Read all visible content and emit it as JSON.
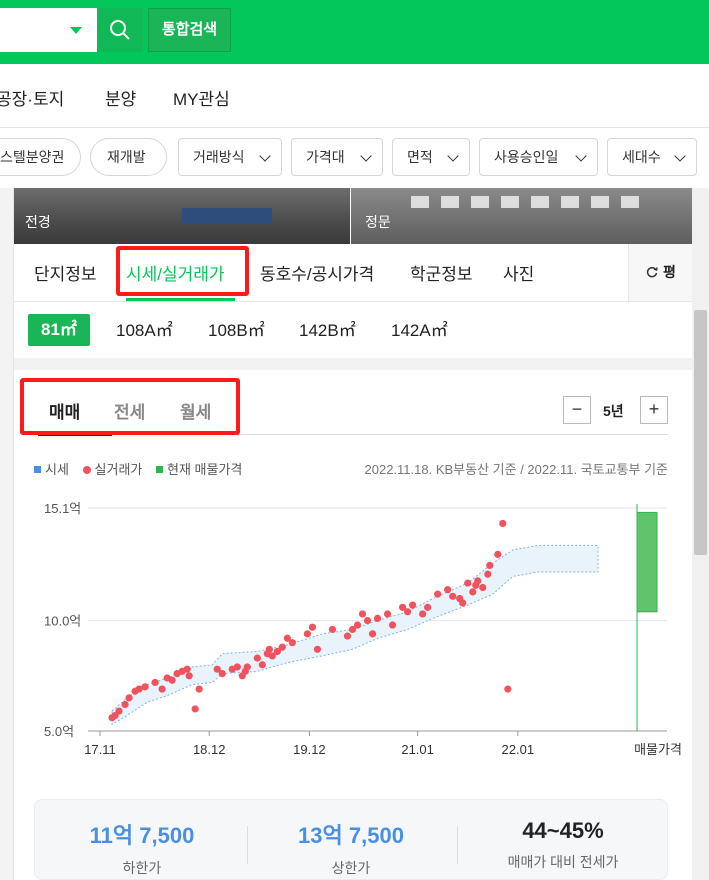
{
  "header": {
    "total_search": "통합검색"
  },
  "gnb": [
    "공장·토지",
    "분양",
    "MY관심"
  ],
  "filters": [
    "스텔분양권",
    "재개발",
    "거래방식",
    "가격대",
    "면적",
    "사용승인일",
    "세대수"
  ],
  "photos": {
    "left_label": "전경",
    "right_label": "정문"
  },
  "tabs": {
    "items": [
      "단지정보",
      "시세/실거래가",
      "동호수/공시가격",
      "학군정보",
      "사진"
    ],
    "active": 1,
    "unit": "평"
  },
  "sizes": {
    "items": [
      "81㎡",
      "108A㎡",
      "108B㎡",
      "142B㎡",
      "142A㎡"
    ],
    "active": 0
  },
  "trade_tabs": {
    "items": [
      "매매",
      "전세",
      "월세"
    ],
    "active": 0
  },
  "period": {
    "minus": "−",
    "label": "5년",
    "plus": "+"
  },
  "legend": {
    "market": "시세",
    "actual": "실거래가",
    "listing": "현재 매물가격",
    "source": "2022.11.18. KB부동산 기준 / 2022.11. 국토교통부 기준",
    "colors": {
      "market": "#4a90e2",
      "actual": "#f0525e",
      "listing": "#2db84d"
    }
  },
  "chart_data": {
    "type": "scatter",
    "y_unit": "억",
    "ylim": [
      5.0,
      15.1
    ],
    "yticks": [
      {
        "value": 5.0,
        "label": "5.0억"
      },
      {
        "value": 10.0,
        "label": "10.0억"
      },
      {
        "value": 15.1,
        "label": "15.1억"
      }
    ],
    "xlim": [
      2017.83,
      2022.92
    ],
    "xticks": [
      {
        "value": 2017.83,
        "label": "17.11"
      },
      {
        "value": 2018.92,
        "label": "18.12"
      },
      {
        "value": 2019.92,
        "label": "19.12"
      },
      {
        "value": 2021.0,
        "label": "21.01"
      },
      {
        "value": 2022.0,
        "label": "22.01"
      }
    ],
    "extra_xlabel": "매물가격",
    "grid": true,
    "series": [
      {
        "name": "시세",
        "band": [
          {
            "x": 2017.95,
            "low": 5.3,
            "high": 5.9
          },
          {
            "x": 2018.1,
            "low": 5.7,
            "high": 6.5
          },
          {
            "x": 2018.3,
            "low": 6.3,
            "high": 7.1
          },
          {
            "x": 2018.5,
            "low": 6.6,
            "high": 7.4
          },
          {
            "x": 2018.75,
            "low": 7.1,
            "high": 7.9
          },
          {
            "x": 2018.95,
            "low": 7.2,
            "high": 8.0
          },
          {
            "x": 2019.05,
            "low": 7.6,
            "high": 8.5
          },
          {
            "x": 2019.4,
            "low": 7.7,
            "high": 8.6
          },
          {
            "x": 2019.7,
            "low": 8.1,
            "high": 8.9
          },
          {
            "x": 2020.05,
            "low": 8.4,
            "high": 9.4
          },
          {
            "x": 2020.35,
            "low": 8.7,
            "high": 9.6
          },
          {
            "x": 2020.6,
            "low": 9.2,
            "high": 10.0
          },
          {
            "x": 2020.9,
            "low": 9.6,
            "high": 10.4
          },
          {
            "x": 2021.15,
            "low": 10.1,
            "high": 11.0
          },
          {
            "x": 2021.5,
            "low": 10.7,
            "high": 11.7
          },
          {
            "x": 2021.75,
            "low": 11.2,
            "high": 12.6
          },
          {
            "x": 2021.95,
            "low": 12.0,
            "high": 13.2
          },
          {
            "x": 2022.2,
            "low": 12.2,
            "high": 13.4
          },
          {
            "x": 2022.8,
            "low": 12.2,
            "high": 13.4
          }
        ]
      },
      {
        "name": "실거래가",
        "points": [
          [
            2017.95,
            5.6
          ],
          [
            2017.98,
            5.7
          ],
          [
            2018.02,
            5.9
          ],
          [
            2018.08,
            6.2
          ],
          [
            2018.12,
            6.5
          ],
          [
            2018.18,
            6.8
          ],
          [
            2018.22,
            6.9
          ],
          [
            2018.28,
            7.0
          ],
          [
            2018.38,
            7.2
          ],
          [
            2018.45,
            6.9
          ],
          [
            2018.5,
            7.4
          ],
          [
            2018.55,
            7.3
          ],
          [
            2018.6,
            7.6
          ],
          [
            2018.65,
            7.7
          ],
          [
            2018.7,
            7.8
          ],
          [
            2018.72,
            7.5
          ],
          [
            2018.78,
            6.0
          ],
          [
            2018.82,
            6.9
          ],
          [
            2019.0,
            7.8
          ],
          [
            2019.05,
            7.6
          ],
          [
            2019.15,
            7.8
          ],
          [
            2019.2,
            7.9
          ],
          [
            2019.25,
            7.5
          ],
          [
            2019.28,
            7.7
          ],
          [
            2019.3,
            7.9
          ],
          [
            2019.4,
            8.3
          ],
          [
            2019.45,
            8.0
          ],
          [
            2019.5,
            8.5
          ],
          [
            2019.52,
            8.7
          ],
          [
            2019.55,
            8.4
          ],
          [
            2019.6,
            8.6
          ],
          [
            2019.65,
            8.8
          ],
          [
            2019.7,
            9.2
          ],
          [
            2019.75,
            9.0
          ],
          [
            2019.9,
            9.4
          ],
          [
            2019.95,
            9.7
          ],
          [
            2020.0,
            8.7
          ],
          [
            2020.15,
            9.6
          ],
          [
            2020.3,
            9.3
          ],
          [
            2020.35,
            9.6
          ],
          [
            2020.4,
            9.8
          ],
          [
            2020.45,
            10.3
          ],
          [
            2020.5,
            10.0
          ],
          [
            2020.55,
            9.4
          ],
          [
            2020.6,
            10.1
          ],
          [
            2020.7,
            10.3
          ],
          [
            2020.75,
            9.8
          ],
          [
            2020.85,
            10.6
          ],
          [
            2020.9,
            10.4
          ],
          [
            2020.95,
            10.7
          ],
          [
            2021.05,
            10.3
          ],
          [
            2021.1,
            10.6
          ],
          [
            2021.2,
            11.2
          ],
          [
            2021.3,
            11.4
          ],
          [
            2021.35,
            11.1
          ],
          [
            2021.42,
            11.0
          ],
          [
            2021.45,
            10.8
          ],
          [
            2021.5,
            11.7
          ],
          [
            2021.55,
            11.3
          ],
          [
            2021.58,
            11.6
          ],
          [
            2021.6,
            11.8
          ],
          [
            2021.65,
            11.5
          ],
          [
            2021.7,
            12.1
          ],
          [
            2021.72,
            12.5
          ],
          [
            2021.8,
            13.0
          ],
          [
            2021.85,
            14.4
          ],
          [
            2021.9,
            6.9
          ]
        ]
      },
      {
        "name": "현재 매물가격",
        "range": {
          "low": 10.4,
          "high": 14.9
        }
      }
    ]
  },
  "summary": [
    {
      "value": "11억 7,500",
      "label": "하한가"
    },
    {
      "value": "13억 7,500",
      "label": "상한가"
    },
    {
      "value": "44~45%",
      "label": "매매가 대비 전세가"
    }
  ]
}
